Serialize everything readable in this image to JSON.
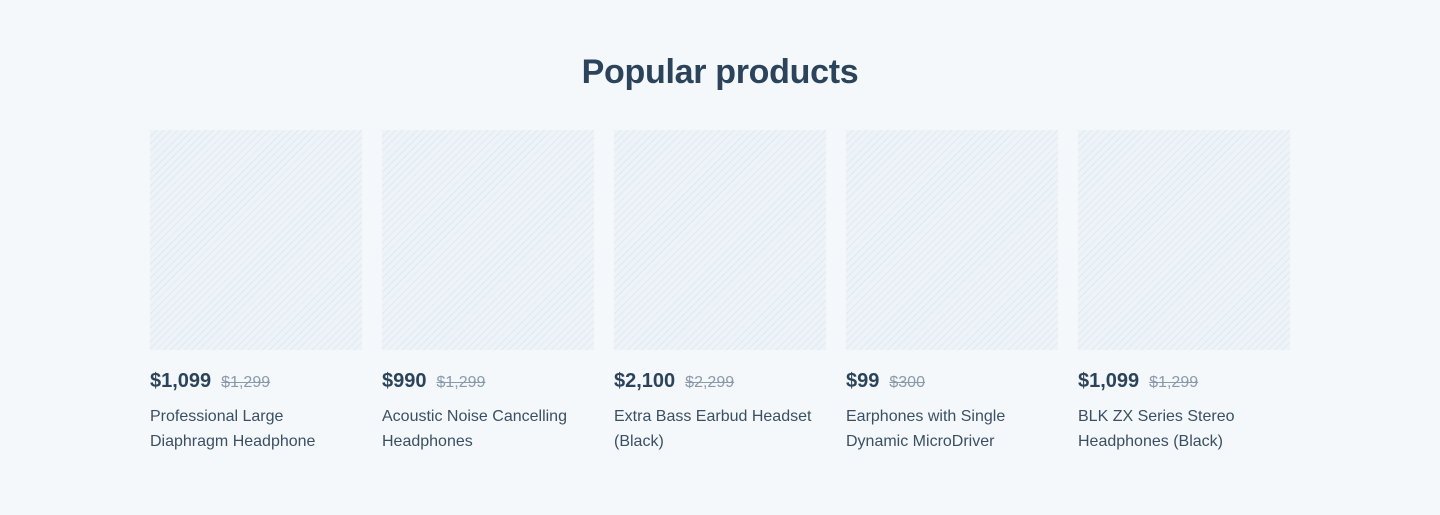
{
  "section": {
    "title": "Popular products"
  },
  "products": [
    {
      "price": "$1,099",
      "old_price": "$1,299",
      "name": "Professional Large Diaphragm Headphone"
    },
    {
      "price": "$990",
      "old_price": "$1,299",
      "name": "Acoustic Noise Cancelling Headphones"
    },
    {
      "price": "$2,100",
      "old_price": "$2,299",
      "name": "Extra Bass Earbud Headset (Black)"
    },
    {
      "price": "$99",
      "old_price": "$300",
      "name": "Earphones with Single Dynamic MicroDriver"
    },
    {
      "price": "$1,099",
      "old_price": "$1,299",
      "name": "BLK ZX Series Stereo Headphones (Black)"
    }
  ],
  "colors": {
    "background": "#f4f8fb",
    "heading": "#2c445b",
    "price": "#2c445b",
    "old_price": "#8a9aaa",
    "image_placeholder": "#eef3f8",
    "image_stripe": "#e1e9f1"
  }
}
